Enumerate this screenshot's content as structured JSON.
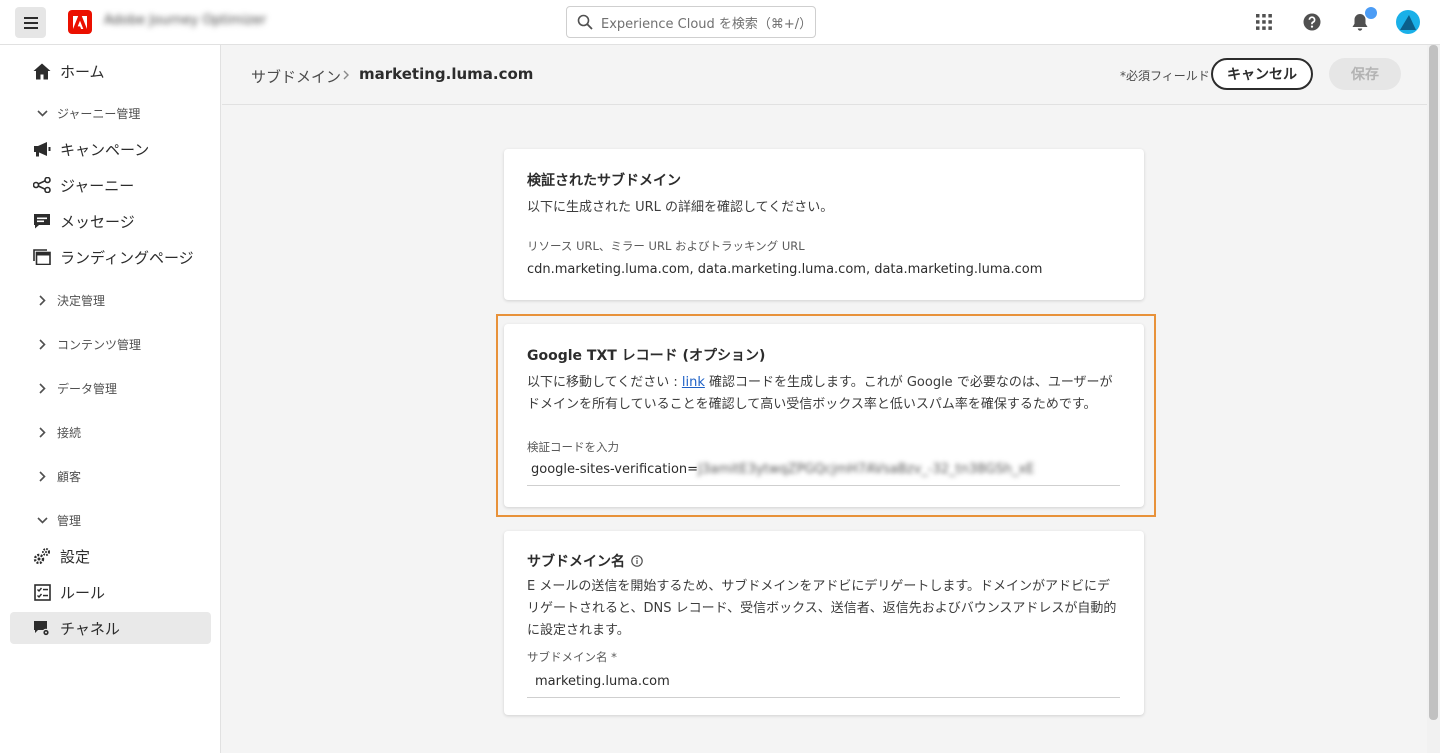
{
  "topbar": {
    "app_name": "Adobe Journey Optimizer",
    "search_placeholder": "Experience Cloud を検索（⌘+/）"
  },
  "sidebar": {
    "home": "ホーム",
    "sections": {
      "journey_mgmt": "ジャーニー管理",
      "decision_mgmt": "決定管理",
      "content_mgmt": "コンテンツ管理",
      "data_mgmt": "データ管理",
      "connections": "接続",
      "customers": "顧客",
      "admin": "管理"
    },
    "items": {
      "campaigns": "キャンペーン",
      "journeys": "ジャーニー",
      "messages": "メッセージ",
      "landing_pages": "ランディングページ",
      "settings": "設定",
      "rules": "ルール",
      "channels": "チャネル"
    }
  },
  "header": {
    "breadcrumb_parent": "サブドメイン",
    "breadcrumb_current": "marketing.luma.com",
    "required_note": "*必須フィールド",
    "cancel_label": "キャンセル",
    "save_label": "保存"
  },
  "verified_card": {
    "title": "検証されたサブドメイン",
    "description": "以下に生成された URL の詳細を確認してください。",
    "urls_label": "リソース URL、ミラー URL およびトラッキング URL",
    "urls_value": "cdn.marketing.luma.com, data.marketing.luma.com, data.marketing.luma.com"
  },
  "google_card": {
    "title": "Google TXT レコード (オプション)",
    "desc_prefix": "以下に移動してください : ",
    "link_text": "link",
    "desc_suffix": " 確認コードを生成します。これが Google で必要なのは、ユーザーがドメインを所有していることを確認して高い受信ボックス率と低いスパム率を確保するためです。",
    "code_label": "検証コードを入力",
    "code_prefix": "google-sites-verification=",
    "code_value": "J3amitE3ytwqZPGQcjmH7AVsaBzv_-32_tn38GSh_xE"
  },
  "subdomain_card": {
    "title": "サブドメイン名",
    "description": "E メールの送信を開始するため、サブドメインをアドビにデリゲートします。ドメインがアドビにデリゲートされると、DNS レコード、受信ボックス、送信者、返信先およびバウンスアドレスが自動的に設定されます。",
    "field_label": "サブドメイン名",
    "required_mark": "*",
    "field_value": "marketing.luma.com"
  },
  "colors": {
    "highlight": "#e8923a",
    "link": "#1e61c6",
    "adobe_red": "#eb1000",
    "notification": "#4b9cf5"
  }
}
